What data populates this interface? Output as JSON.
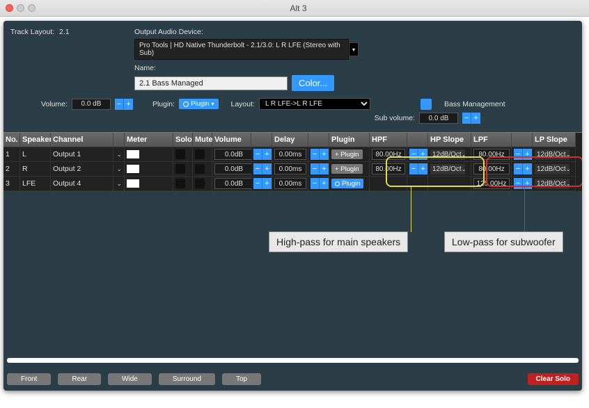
{
  "window": {
    "title": "Alt 3"
  },
  "top": {
    "track_layout_label": "Track Layout:",
    "track_layout_value": "2.1",
    "output_device_label": "Output Audio Device:",
    "output_device_value": "Pro Tools | HD Native Thunderbolt - 2.1/3.0: L R LFE (Stereo with Sub)",
    "name_label": "Name:",
    "name_value": "2.1 Bass Managed",
    "color_button": "Color...",
    "volume_label": "Volume:",
    "volume_value": "0.0 dB",
    "plugin_label": "Plugin:",
    "plugin_value": "Plugin",
    "layout_label": "Layout:",
    "layout_value": "L R LFE->L R LFE",
    "bass_mgmt_label": "Bass Management",
    "sub_vol_label": "Sub volume:",
    "sub_vol_value": "0.0 dB"
  },
  "columns": [
    "No.",
    "Speaker",
    "Channel",
    "",
    "Meter",
    "Solo",
    "Mute",
    "Volume",
    "",
    "Delay",
    "",
    "Plugin",
    "HPF",
    "",
    "HP Slope",
    "LPF",
    "",
    "LP Slope"
  ],
  "rows": [
    {
      "no": "1",
      "spk": "L",
      "chan": "Output 1",
      "meter": true,
      "solo": false,
      "mute": false,
      "vol": "0.0dB",
      "delay": "0.00ms",
      "plugin": "Plugin",
      "plugin_active": false,
      "hpf": "80.00Hz",
      "hps": "12dB/Oct",
      "lpf": "80.00Hz",
      "lps": "12dB/Oct"
    },
    {
      "no": "2",
      "spk": "R",
      "chan": "Output 2",
      "meter": true,
      "solo": false,
      "mute": false,
      "vol": "0.0dB",
      "delay": "0.00ms",
      "plugin": "Plugin",
      "plugin_active": false,
      "hpf": "80.00Hz",
      "hps": "12dB/Oct",
      "lpf": "80.00Hz",
      "lps": "12dB/Oct"
    },
    {
      "no": "3",
      "spk": "LFE",
      "chan": "Output 4",
      "meter": true,
      "solo": false,
      "mute": false,
      "vol": "0.0dB",
      "delay": "0.00ms",
      "plugin": "Plugin",
      "plugin_active": true,
      "hpf": "",
      "hps": "",
      "lpf": "125.00Hz",
      "lps": "12dB/Oct"
    }
  ],
  "footer": {
    "buttons": [
      "Front",
      "Rear",
      "Wide",
      "Surround",
      "Top"
    ],
    "clear": "Clear Solo"
  },
  "annotations": {
    "hp": "High-pass for main speakers",
    "lp": "Low-pass for subwoofer"
  }
}
